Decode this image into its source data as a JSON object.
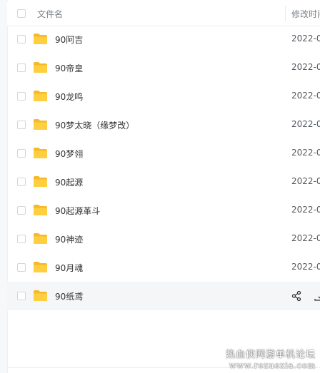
{
  "header": {
    "col_name": "文件名",
    "col_modified": "修改时间"
  },
  "files": [
    {
      "name": "90阿吉",
      "modified": "2022-0"
    },
    {
      "name": "90帝皇",
      "modified": "2022-0"
    },
    {
      "name": "90龙鸣",
      "modified": "2022-0"
    },
    {
      "name": "90梦太晓（缘梦改）",
      "modified": "2022-0"
    },
    {
      "name": "90梦翎",
      "modified": "2022-0"
    },
    {
      "name": "90起源",
      "modified": "2022-0"
    },
    {
      "name": "90起源革斗",
      "modified": "2022-0"
    },
    {
      "name": "90神迹",
      "modified": "2022-0"
    },
    {
      "name": "90月魂",
      "modified": "2022-0"
    },
    {
      "name": "90纸鸢",
      "modified": ""
    }
  ],
  "row_actions": {
    "share_icon": "share-icon",
    "download_icon": "download-icon"
  },
  "watermark": {
    "line1": "热血侠网游单机论坛",
    "line2": "www.rexuexia.com"
  },
  "colors": {
    "folder": "#ffcf3f",
    "folder_tab": "#f7b92a",
    "hover_row": "#f5f6f8",
    "text": "#333333",
    "muted": "#7a8088"
  }
}
